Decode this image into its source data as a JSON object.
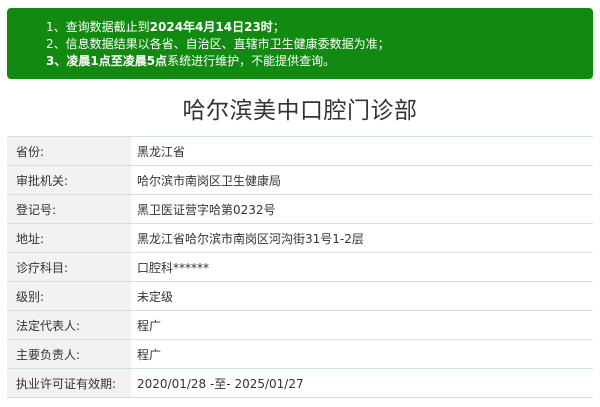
{
  "notice": {
    "line1": {
      "prefix": "1、查询数据截止到",
      "bold": "2024年4月14日23时",
      "suffix": "；"
    },
    "line2": {
      "text": "2、信息数据结果以各省、自治区、直辖市卫生健康委数据为准；"
    },
    "line3": {
      "bold": "3、凌晨1点至凌晨5点",
      "suffix": "系统进行维护，不能提供查询。"
    }
  },
  "title": "哈尔滨美中口腔门诊部",
  "fields": [
    {
      "label": "省份:",
      "value": "黑龙江省"
    },
    {
      "label": "审批机关:",
      "value": "哈尔滨市南岗区卫生健康局"
    },
    {
      "label": "登记号:",
      "value": "黑卫医证营字哈第0232号"
    },
    {
      "label": "地址:",
      "value": "黑龙江省哈尔滨市南岗区河沟街31号1-2层"
    },
    {
      "label": "诊疗科目:",
      "value": "口腔科******"
    },
    {
      "label": "级别:",
      "value": "未定级"
    },
    {
      "label": "法定代表人:",
      "value": "程广"
    },
    {
      "label": "主要负责人:",
      "value": "程广"
    },
    {
      "label": "执业许可证有效期:",
      "value": "2020/01/28 -至- 2025/01/27"
    }
  ],
  "colors": {
    "notice_bg": "#128a12",
    "label_bg": "#f2f2f2",
    "row_border": "#cfe3e3"
  }
}
